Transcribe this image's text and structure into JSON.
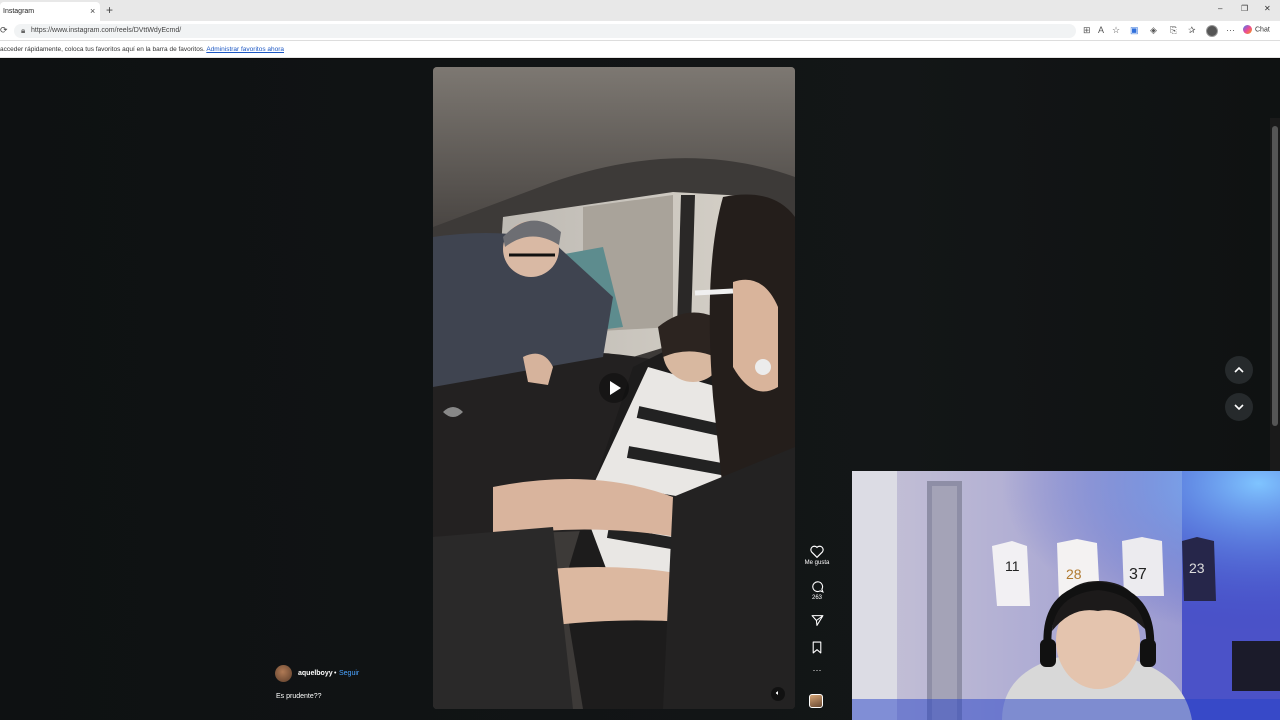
{
  "browser": {
    "tab_title": "Instagram",
    "tab_close": "×",
    "new_tab": "+",
    "url": "https://www.instagram.com/reels/DVttWdyEcmd/",
    "chat_label": "Chat",
    "win_min": "–",
    "win_max": "❐",
    "win_close": "✕"
  },
  "favorites_bar": {
    "text": "acceder rápidamente, coloca tus favoritos aquí en la barra de favoritos.",
    "link": "Administrar favoritos ahora"
  },
  "reel": {
    "author": "aquelboyy",
    "separator": "•",
    "follow_label": "Seguir",
    "caption": "Es prudente??",
    "like_label": "Me gusta",
    "comment_count": "263",
    "more_label": "···"
  },
  "icons": [
    "heart-icon",
    "comment-icon",
    "share-icon",
    "bookmark-icon",
    "more-icon",
    "play-icon",
    "mute-icon",
    "chevron-up-icon",
    "chevron-down-icon"
  ],
  "colors": {
    "page_bg": "#0e1112",
    "link_blue": "#4aa3ff",
    "fav_link": "#1a56c4"
  }
}
